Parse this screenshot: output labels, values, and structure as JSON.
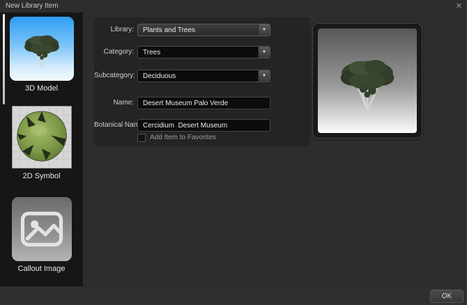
{
  "window": {
    "title": "New Library Item"
  },
  "icons": {
    "close": "✕",
    "dropdown_arrow": "▼"
  },
  "sidebar": {
    "items": [
      {
        "label": "3D Model",
        "selected": true
      },
      {
        "label": "2D Symbol",
        "selected": false
      },
      {
        "label": "Callout Image",
        "selected": false
      }
    ]
  },
  "form": {
    "library": {
      "label": "Library:",
      "value": "Plants and Trees"
    },
    "category": {
      "label": "Category:",
      "value": "Trees"
    },
    "subcategory": {
      "label": "Subcategory:",
      "value": "Deciduous"
    },
    "name": {
      "label": "Name:",
      "value": "Desert Museum Palo Verde"
    },
    "botanical": {
      "label": "Botanical Name:",
      "value": "Cercidium  Desert Museum"
    },
    "favorites": {
      "label": "Add Item to Favorites",
      "checked": false
    }
  },
  "footer": {
    "ok": "OK"
  },
  "colors": {
    "dialog_bg": "#2d2d2d",
    "sidebar_bg": "#161616",
    "panel_bg": "#242424",
    "field_bg": "#0c0c0c",
    "sky_blue": "#2d9ef5",
    "canopy_green": "#6f8a3d",
    "selection_bar": "#d9d9d9"
  }
}
